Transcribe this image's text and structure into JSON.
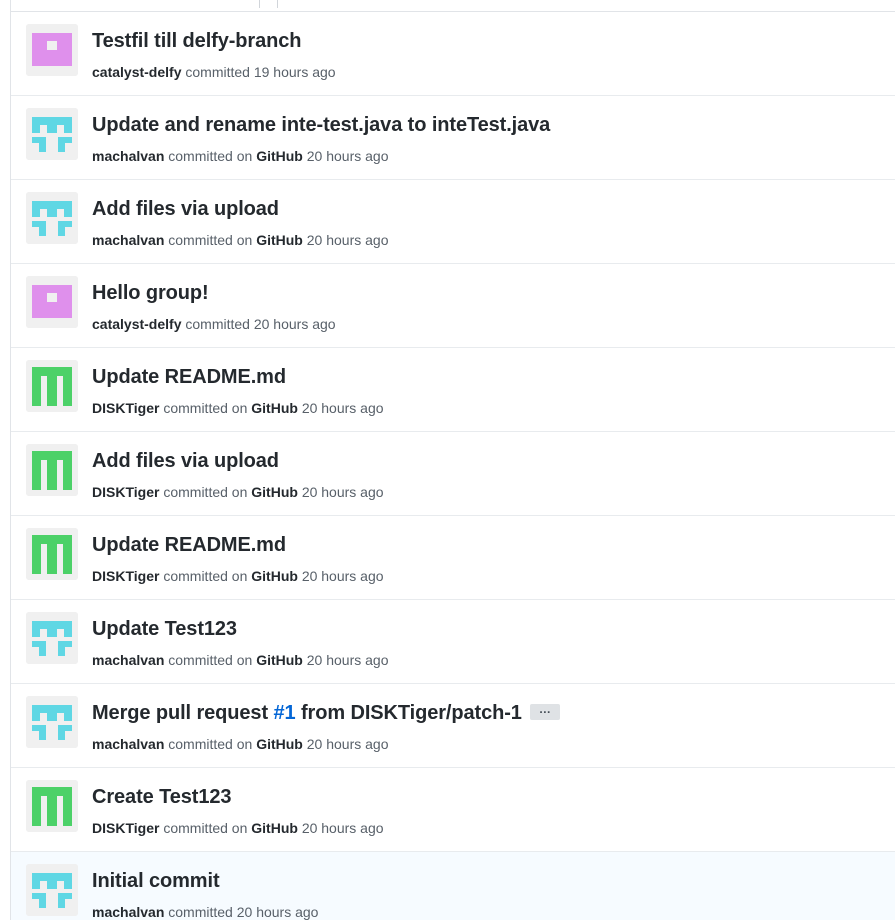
{
  "colors": {
    "purple_avatar": "#df90ec",
    "cyan_avatar": "#5fd7e4",
    "green_avatar": "#4cd168",
    "avatar_bg": "#f0f0f0",
    "link": "#0366d6"
  },
  "commits": [
    {
      "avatar": "purple-identicon",
      "title": "Testfil till delfy-branch",
      "author": "catalyst-delfy",
      "verb": "committed",
      "platform": "",
      "time": "19 hours ago"
    },
    {
      "avatar": "cyan-identicon",
      "title": "Update and rename inte-test.java to inteTest.java",
      "author": "machalvan",
      "verb": "committed on",
      "platform": "GitHub",
      "time": "20 hours ago"
    },
    {
      "avatar": "cyan-identicon",
      "title": "Add files via upload",
      "author": "machalvan",
      "verb": "committed on",
      "platform": "GitHub",
      "time": "20 hours ago"
    },
    {
      "avatar": "purple-identicon",
      "title": "Hello group!",
      "author": "catalyst-delfy",
      "verb": "committed",
      "platform": "",
      "time": "20 hours ago"
    },
    {
      "avatar": "green-identicon",
      "title": "Update README.md",
      "author": "DISKTiger",
      "verb": "committed on",
      "platform": "GitHub",
      "time": "20 hours ago"
    },
    {
      "avatar": "green-identicon",
      "title": "Add files via upload",
      "author": "DISKTiger",
      "verb": "committed on",
      "platform": "GitHub",
      "time": "20 hours ago"
    },
    {
      "avatar": "green-identicon",
      "title": "Update README.md",
      "author": "DISKTiger",
      "verb": "committed on",
      "platform": "GitHub",
      "time": "20 hours ago"
    },
    {
      "avatar": "cyan-identicon",
      "title": "Update Test123",
      "author": "machalvan",
      "verb": "committed on",
      "platform": "GitHub",
      "time": "20 hours ago"
    },
    {
      "avatar": "cyan-identicon",
      "title_prefix": "Merge pull request ",
      "title_link": "#1",
      "title_suffix": " from DISKTiger/patch-1",
      "expand_label": "…",
      "author": "machalvan",
      "verb": "committed on",
      "platform": "GitHub",
      "time": "20 hours ago"
    },
    {
      "avatar": "green-identicon",
      "title": "Create Test123",
      "author": "DISKTiger",
      "verb": "committed on",
      "platform": "GitHub",
      "time": "20 hours ago"
    },
    {
      "avatar": "cyan-identicon",
      "title": "Initial commit",
      "author": "machalvan",
      "verb": "committed",
      "platform": "",
      "time": "20 hours ago"
    }
  ]
}
